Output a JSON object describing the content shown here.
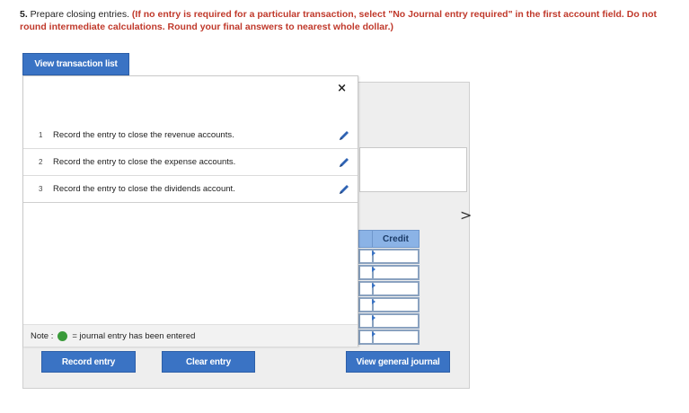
{
  "instructions": {
    "number": "5.",
    "text": " Prepare closing entries. ",
    "note": "(If no entry is required for a particular transaction, select \"No Journal entry required\" in the first account field. Do not round intermediate calculations. Round your final answers to nearest whole dollar.)"
  },
  "buttons": {
    "view_transaction_list": "View transaction list",
    "record_entry": "Record entry",
    "clear_entry": "Clear entry",
    "view_general_journal": "View general journal"
  },
  "panel": {
    "close_symbol": "×",
    "items": [
      {
        "index": "1",
        "label": "Record the entry to close the revenue accounts."
      },
      {
        "index": "2",
        "label": "Record the entry to close the expense accounts."
      },
      {
        "index": "3",
        "label": "Record the entry to close the dividends account."
      }
    ],
    "note_prefix": "Note :",
    "note_suffix": "= journal entry has been entered"
  },
  "ledger": {
    "credit_header": "Credit"
  },
  "nav": {
    "next_symbol": ">"
  },
  "colors": {
    "accent": "#3a73c4",
    "instruction_red": "#c0392b",
    "entered_dot": "#3a9a3a",
    "header_fill": "#8bb3e6"
  },
  "icons": [
    "pencil-icon",
    "close-icon",
    "chevron-right-icon",
    "green-dot-icon"
  ]
}
